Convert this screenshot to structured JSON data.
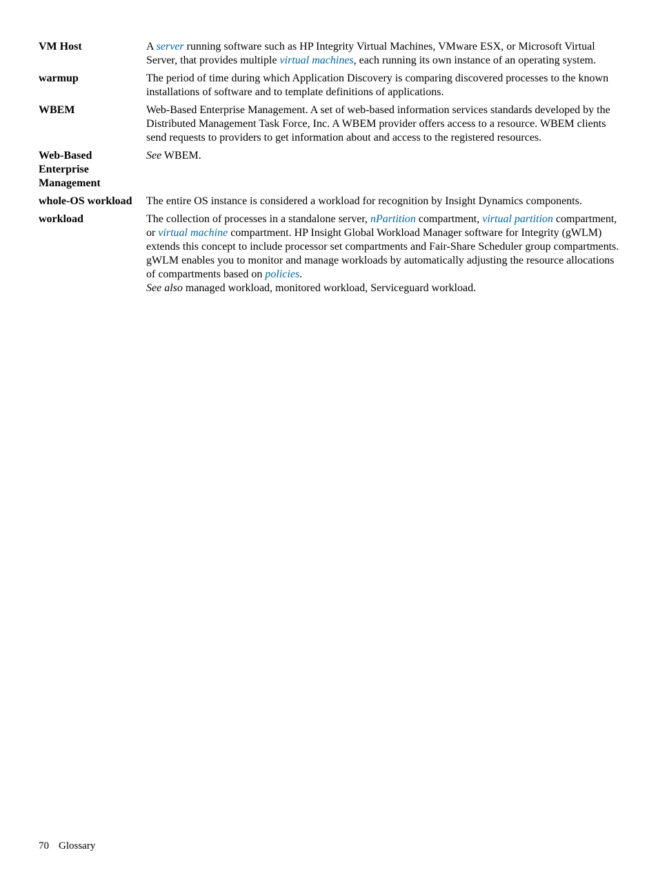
{
  "entries": {
    "vm_host": {
      "term": "VM Host",
      "def_part_a": "A ",
      "link_server": "server",
      "def_part_b": " running software such as HP Integrity Virtual Machines, VMware ESX, or Microsoft Virtual Server, that provides multiple ",
      "link_virtual_machines": "virtual machines",
      "def_part_c": ", each running its own instance of an operating system."
    },
    "warmup": {
      "term": "warmup",
      "def": "The period of time during which Application Discovery is comparing discovered processes to the known installations of software and to template definitions of applications."
    },
    "wbem": {
      "term": "WBEM",
      "def": "Web-Based Enterprise Management. A set of web-based information services standards developed by the Distributed Management Task Force, Inc. A WBEM provider offers access to a resource. WBEM clients send requests to providers to get information about and access to the registered resources."
    },
    "web_based_em": {
      "term": "Web-Based Enterprise Management",
      "see_label": "See",
      "see_target": " WBEM."
    },
    "whole_os": {
      "term": "whole-OS workload",
      "def": "The entire OS instance is considered a workload for recognition by Insight Dynamics components."
    },
    "workload": {
      "term": "workload",
      "def_part_a": "The collection of processes in a standalone server, ",
      "link_npartition": "nPartition",
      "def_part_b": " compartment, ",
      "link_virtual_partition": "virtual partition",
      "def_part_c": " compartment, or ",
      "link_virtual_machine": "virtual machine",
      "def_part_d": " compartment. HP Insight Global Workload Manager software for Integrity (gWLM) extends this concept to include processor set compartments and Fair-Share Scheduler group compartments. gWLM enables you to monitor and manage workloads by automatically adjusting the resource allocations of compartments based on ",
      "link_policies": "policies",
      "def_part_e": ".",
      "see_also_label": "See also",
      "see_also_text": " managed workload, monitored workload, Serviceguard workload."
    }
  },
  "footer": {
    "page_number": "70",
    "section": "Glossary"
  }
}
